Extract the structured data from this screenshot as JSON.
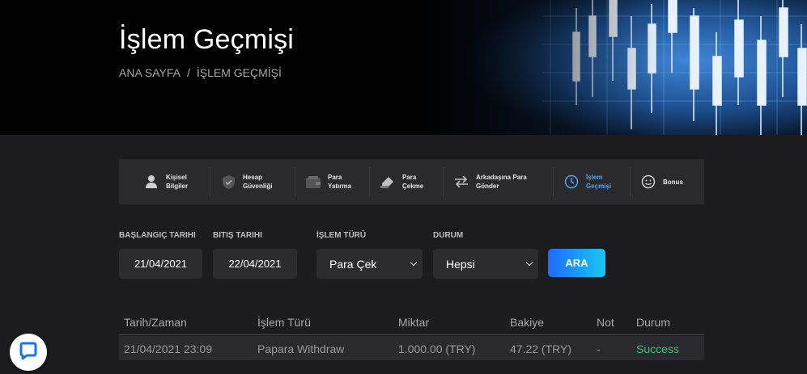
{
  "header": {
    "title": "İşlem Geçmişi",
    "breadcrumb": {
      "home": "ANA SAYFA",
      "separator": "/",
      "current": "İŞLEM GEÇMİŞİ"
    }
  },
  "tabs": [
    {
      "label": "Kişisel\nBilgiler",
      "icon": "user-icon",
      "active": false
    },
    {
      "label": "Hesap\nGüvenliği",
      "icon": "shield-icon",
      "active": false
    },
    {
      "label": "Para\nYatırma",
      "icon": "wallet-icon",
      "active": false
    },
    {
      "label": "Para\nÇekme",
      "icon": "withdraw-icon",
      "active": false
    },
    {
      "label": "Arkadaşına Para\nGönder",
      "icon": "transfer-icon",
      "active": false
    },
    {
      "label": "İşlem\nGeçmişi",
      "icon": "history-icon",
      "active": true
    },
    {
      "label": "Bonus",
      "icon": "smile-icon",
      "active": false
    }
  ],
  "filters": {
    "start_label": "BAŞLANGIÇ TARIHI",
    "start_value": "21/04/2021",
    "end_label": "BITIŞ TARIHI",
    "end_value": "22/04/2021",
    "type_label": "İŞLEM TÜRÜ",
    "type_value": "Para Çek",
    "status_label": "DURUM",
    "status_value": "Hepsi",
    "search_label": "ARA"
  },
  "table": {
    "headers": [
      "Tarih/Zaman",
      "İşlem Türü",
      "Miktar",
      "Bakiye",
      "Not",
      "Durum"
    ],
    "rows": [
      [
        "21/04/2021 23:09",
        "Papara Withdraw",
        "1.000.00 (TRY)",
        "47.22 (TRY)",
        "-",
        "Success"
      ]
    ]
  },
  "colors": {
    "accent": "#4aa3ff",
    "success": "#3cc66a",
    "button_gradient_start": "#1e6bff",
    "button_gradient_end": "#19c6f5"
  },
  "chat": {
    "icon": "chat-bubble-icon"
  }
}
